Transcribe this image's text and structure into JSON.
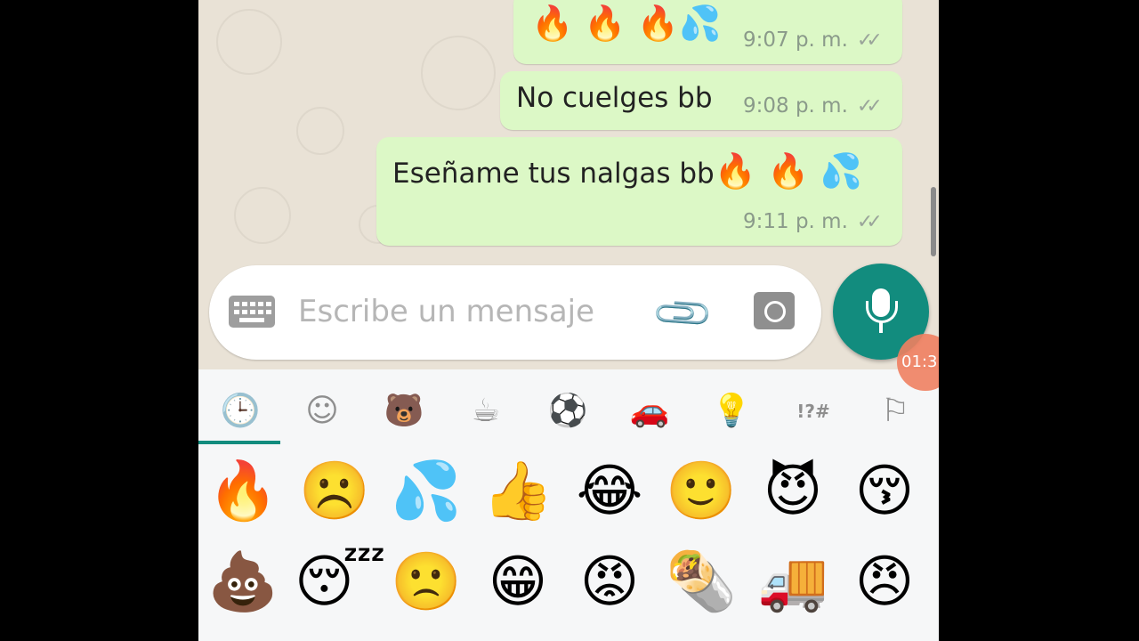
{
  "messages": [
    {
      "text": "",
      "emoji": "🔥 🔥 🔥💦",
      "time": "9:07 p. m.",
      "ticks": "✓✓"
    },
    {
      "text": "No cuelges bb",
      "emoji": "",
      "time": "9:08 p. m.",
      "ticks": "✓✓"
    },
    {
      "text": "Eseñame tus nalgas bb",
      "emoji": "🔥 🔥 💦",
      "time": "9:11 p. m.",
      "ticks": "✓✓"
    }
  ],
  "input": {
    "placeholder": "Escribe un mensaje"
  },
  "recording": {
    "timer": "01:3"
  },
  "tabs": [
    "🕒",
    "☺",
    "🐻",
    "☕",
    "⚽",
    "🚗",
    "💡",
    "!?#",
    "⚐"
  ],
  "emoji_rows": [
    [
      "🔥",
      "☹️",
      "💦",
      "👍",
      "😂",
      "🙂",
      "😈",
      "😚"
    ],
    [
      "💩",
      "😴",
      "🙁",
      "😁",
      "😡",
      "🌯",
      "🚚",
      "😠"
    ]
  ],
  "colors": {
    "bubble": "#dcf8c6",
    "accent": "#128c7e",
    "chat_bg": "#e9e2d6"
  }
}
